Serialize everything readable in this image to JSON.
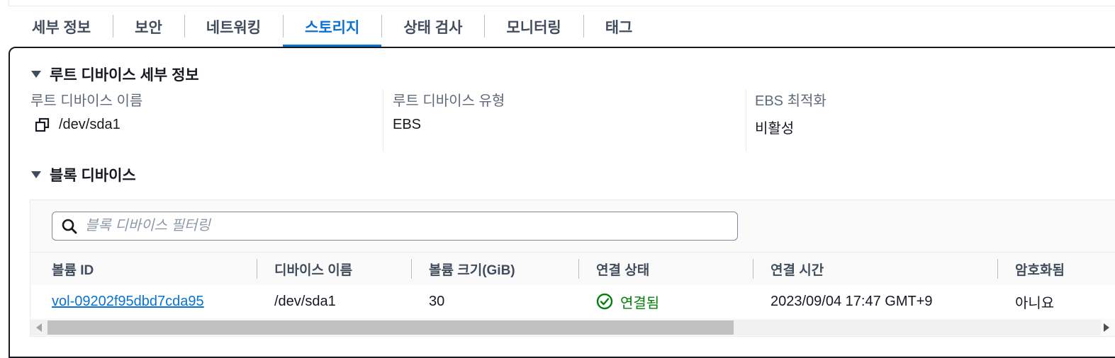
{
  "tabs": [
    {
      "label": "세부 정보",
      "active": false
    },
    {
      "label": "보안",
      "active": false
    },
    {
      "label": "네트워킹",
      "active": false
    },
    {
      "label": "스토리지",
      "active": true
    },
    {
      "label": "상태 검사",
      "active": false
    },
    {
      "label": "모니터링",
      "active": false
    },
    {
      "label": "태그",
      "active": false
    }
  ],
  "root_device": {
    "title": "루트 디바이스 세부 정보",
    "name_label": "루트 디바이스 이름",
    "name_value": "/dev/sda1",
    "type_label": "루트 디바이스 유형",
    "type_value": "EBS",
    "ebs_label": "EBS 최적화",
    "ebs_value": "비활성"
  },
  "block_devices": {
    "title": "블록 디바이스",
    "search_placeholder": "블록 디바이스 필터링",
    "columns": [
      "볼륨 ID",
      "디바이스 이름",
      "볼륨 크기(GiB)",
      "연결 상태",
      "연결 시간",
      "암호화됨"
    ],
    "rows": [
      {
        "volume_id": "vol-09202f95dbd7cda95",
        "device_name": "/dev/sda1",
        "size": "30",
        "status": "연결됨",
        "attach_time": "2023/09/04 17:47 GMT+9",
        "encrypted": "아니요"
      }
    ]
  },
  "colors": {
    "accent": "#0972d3",
    "success": "#037f0c",
    "text": "#16191f",
    "muted": "#5f6b7a"
  },
  "icons": [
    "copy-icon",
    "caret-down-icon",
    "search-icon",
    "check-circle-icon"
  ]
}
